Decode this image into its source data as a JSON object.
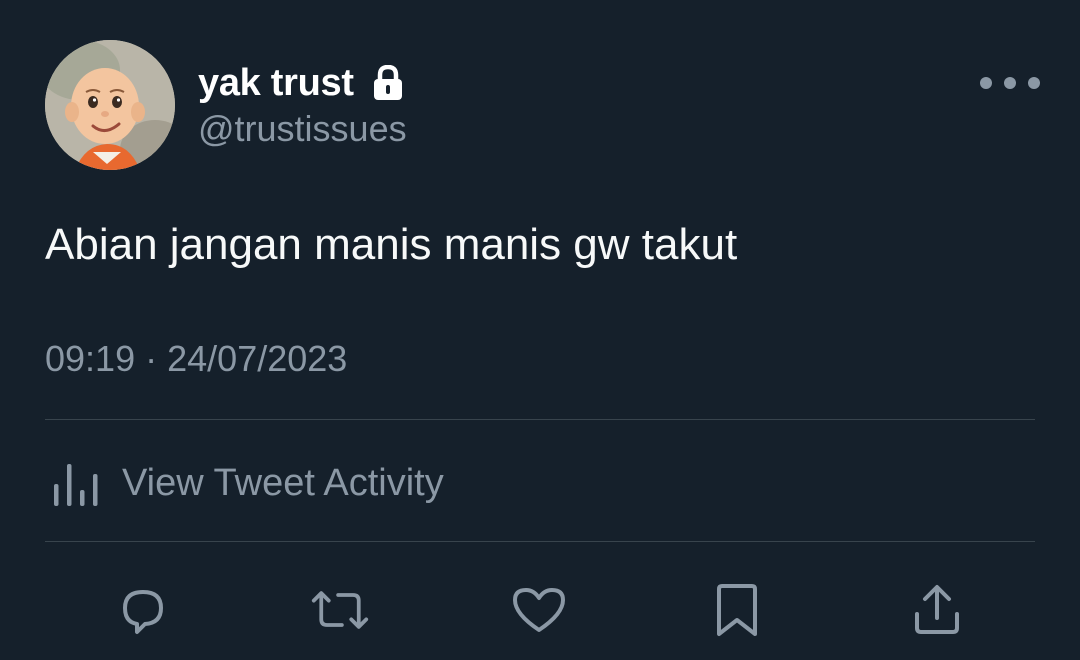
{
  "author": {
    "display_name": "yak trust",
    "handle": "@trustissues",
    "avatar_icon": "avatar-cartoon-boy",
    "protected_icon": "lock-icon"
  },
  "tweet": {
    "text": "Abian jangan manis manis gw takut",
    "time": "09:19",
    "separator": "·",
    "date": "24/07/2023"
  },
  "activity": {
    "label": "View Tweet Activity",
    "icon": "bar-chart-icon"
  },
  "actions": [
    {
      "name": "reply",
      "icon": "reply-icon"
    },
    {
      "name": "retweet",
      "icon": "retweet-icon"
    },
    {
      "name": "like",
      "icon": "heart-icon"
    },
    {
      "name": "bookmark",
      "icon": "bookmark-icon"
    },
    {
      "name": "share",
      "icon": "share-icon"
    }
  ],
  "colors": {
    "background": "#15202b",
    "text_primary": "#f7f9f9",
    "text_secondary": "#8b98a5",
    "divider": "#38444d"
  }
}
